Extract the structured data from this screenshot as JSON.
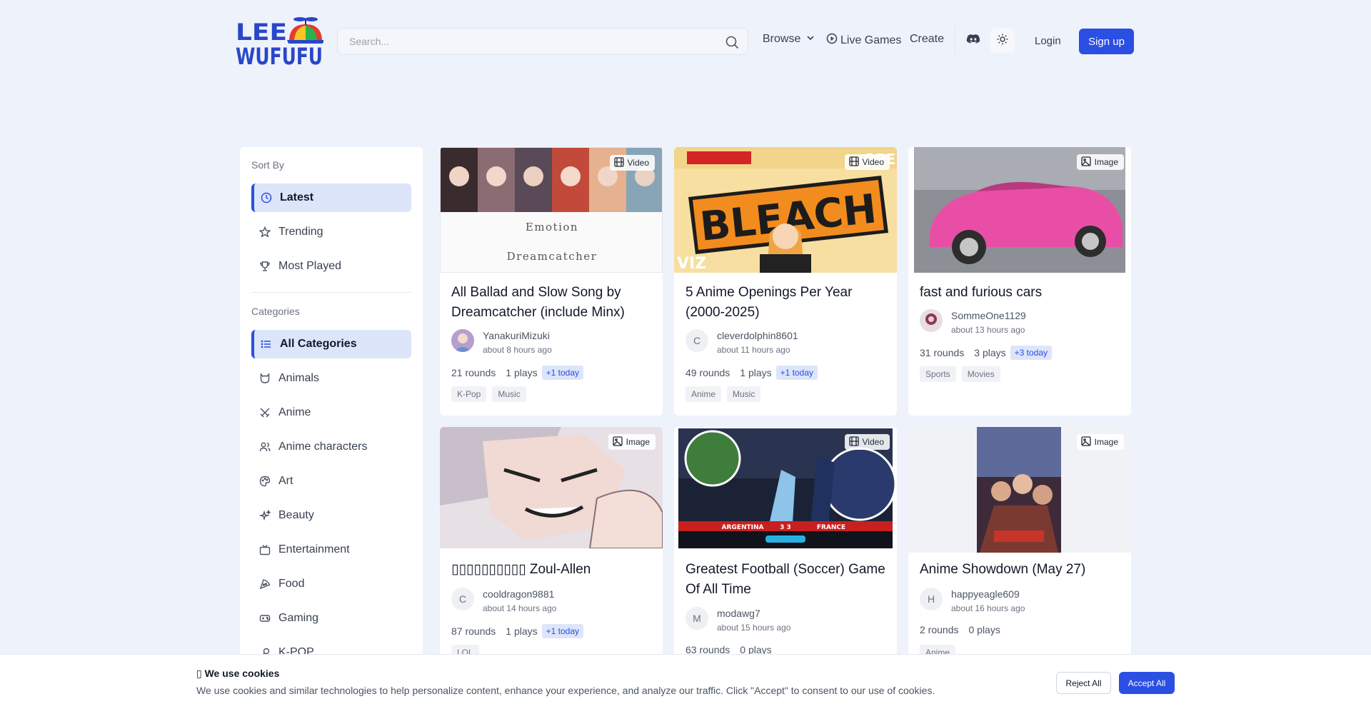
{
  "header": {
    "logo_line1": "LEE",
    "logo_line2": "WUFUFU",
    "search_placeholder": "Search...",
    "nav": {
      "browse": "Browse",
      "live_games": "Live Games",
      "create": "Create"
    },
    "login": "Login",
    "signup": "Sign up"
  },
  "sidebar": {
    "sort_heading": "Sort By",
    "sort_items": [
      {
        "label": "Latest",
        "icon": "clock-icon",
        "active": true
      },
      {
        "label": "Trending",
        "icon": "star-icon"
      },
      {
        "label": "Most Played",
        "icon": "trophy-icon"
      }
    ],
    "categories_heading": "Categories",
    "categories": [
      {
        "label": "All Categories",
        "icon": "list-icon",
        "active": true
      },
      {
        "label": "Animals",
        "icon": "cat-icon"
      },
      {
        "label": "Anime",
        "icon": "swords-icon"
      },
      {
        "label": "Anime characters",
        "icon": "users-icon"
      },
      {
        "label": "Art",
        "icon": "palette-icon"
      },
      {
        "label": "Beauty",
        "icon": "sparkles-icon"
      },
      {
        "label": "Entertainment",
        "icon": "tv-icon"
      },
      {
        "label": "Food",
        "icon": "pizza-icon"
      },
      {
        "label": "Gaming",
        "icon": "gamepad-icon"
      },
      {
        "label": "K-POP",
        "icon": "mic-icon"
      }
    ]
  },
  "cards": [
    {
      "media": "Video",
      "title": "All Ballad and Slow Song by Dreamcatcher (include Minx)",
      "author": "YanakuriMizuki",
      "time": "about 8 hours ago",
      "rounds": "21 rounds",
      "plays": "1 plays",
      "today": "+1 today",
      "tags": [
        "K-Pop",
        "Music"
      ],
      "thumb_text1": "Emotion",
      "thumb_text2": "Dreamcatcher"
    },
    {
      "media": "Video",
      "title": "5 Anime Openings Per Year (2000-2025)",
      "author": "cleverdolphin8601",
      "avatar": "C",
      "time": "about 11 hours ago",
      "rounds": "49 rounds",
      "plays": "1 plays",
      "today": "+1 today",
      "tags": [
        "Anime",
        "Music"
      ],
      "thumb_text1": "BLEACH",
      "thumb_text2": "OPE",
      "thumb_text3": "VIZ"
    },
    {
      "media": "Image",
      "title": "fast and furious cars",
      "author": "SommeOne1129",
      "time": "about 13 hours ago",
      "rounds": "31 rounds",
      "plays": "3 plays",
      "today": "+3 today",
      "tags": [
        "Sports",
        "Movies"
      ]
    },
    {
      "media": "Image",
      "title": "▯▯▯▯▯▯▯▯▯▯ Zoul-Allen",
      "author": "cooldragon9881",
      "avatar": "C",
      "time": "about 14 hours ago",
      "rounds": "87 rounds",
      "plays": "1 plays",
      "today": "+1 today",
      "tags": [
        "LOL"
      ]
    },
    {
      "media": "Video",
      "title": "Greatest Football (Soccer) Game Of All Time",
      "author": "modawg7",
      "avatar": "M",
      "time": "about 15 hours ago",
      "rounds": "63 rounds",
      "plays": "0 plays",
      "tags": [],
      "thumb_text1": "ARGENTINA",
      "thumb_text2": "FRANCE",
      "thumb_score": "3 3"
    },
    {
      "media": "Image",
      "title": "Anime Showdown (May 27)",
      "author": "happyeagle609",
      "avatar": "H",
      "time": "about 16 hours ago",
      "rounds": "2 rounds",
      "plays": "0 plays",
      "tags": [
        "Anime"
      ]
    }
  ],
  "cookie": {
    "title": "▯ We use cookies",
    "text": "We use cookies and similar technologies to help personalize content, enhance your experience, and analyze our traffic. Click \"Accept\" to consent to our use of cookies.",
    "reject": "Reject All",
    "accept": "Accept All"
  },
  "colors": {
    "accent": "#2b4ee3",
    "background": "#eef2fb"
  }
}
